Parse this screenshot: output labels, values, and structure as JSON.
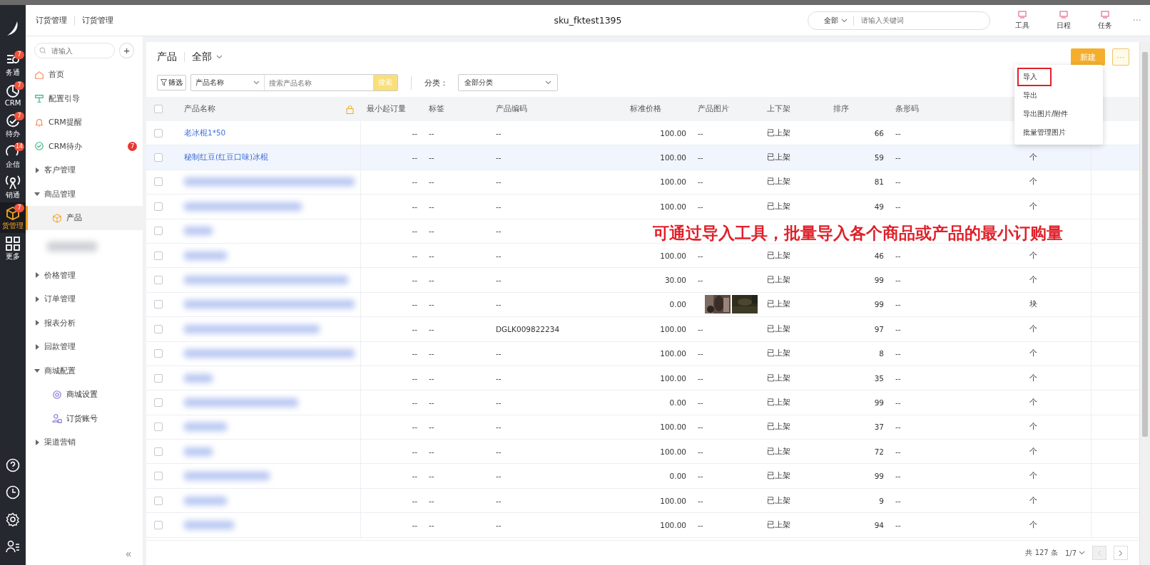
{
  "top_bar": {
    "breadcrumbs": [
      "订货管理",
      "订货管理"
    ],
    "title": "sku_fktest1395",
    "search": {
      "scope": "全部",
      "placeholder": "请输入关键词"
    },
    "tools": [
      "工具",
      "日程",
      "任务"
    ],
    "more": "···"
  },
  "rail": {
    "items": [
      {
        "label": "务通",
        "badge": "7",
        "selected": false
      },
      {
        "label": "CRM",
        "badge": "7",
        "selected": false
      },
      {
        "label": "待办",
        "badge": "7",
        "selected": false
      },
      {
        "label": "企信",
        "badge": "14",
        "selected": false
      },
      {
        "label": "销通",
        "selected": false
      },
      {
        "label": "货管理",
        "badge": "7",
        "selected": true
      },
      {
        "label": "更多",
        "selected": false
      }
    ]
  },
  "sidebar": {
    "search_placeholder": "请输入",
    "add": "+",
    "collapse": "«",
    "items": [
      {
        "kind": "link",
        "label": "首页"
      },
      {
        "kind": "link",
        "label": "配置引导"
      },
      {
        "kind": "link",
        "label": "CRM提醒"
      },
      {
        "kind": "link",
        "label": "CRM待办",
        "badge": "7"
      },
      {
        "kind": "group",
        "label": "客户管理",
        "expanded": false
      },
      {
        "kind": "group",
        "label": "商品管理",
        "expanded": true,
        "children": [
          {
            "kind": "child",
            "label": "产品",
            "selected": true
          },
          {
            "kind": "blurred",
            "selected": false
          }
        ]
      },
      {
        "kind": "group",
        "label": "价格管理",
        "expanded": false
      },
      {
        "kind": "group",
        "label": "订单管理",
        "expanded": false
      },
      {
        "kind": "group",
        "label": "报表分析",
        "expanded": false
      },
      {
        "kind": "group",
        "label": "回款管理",
        "expanded": false
      },
      {
        "kind": "group",
        "label": "商城配置",
        "expanded": true,
        "children": [
          {
            "kind": "child",
            "label": "商城设置",
            "selected": false
          },
          {
            "kind": "child",
            "label": "订货账号",
            "selected": false
          }
        ]
      },
      {
        "kind": "group",
        "label": "渠道营销",
        "expanded": false
      }
    ]
  },
  "toolbar": {
    "title": "产品",
    "view": "全部",
    "filter": "筛选",
    "field_select": "产品名称",
    "search_placeholder": "搜索产品名称",
    "search_button": "搜索",
    "category_label": "分类：",
    "category": "全部分类",
    "new_button": "新建",
    "more": "···"
  },
  "menu": {
    "items": [
      {
        "label": "导入",
        "highlighted": true
      },
      {
        "label": "导出",
        "highlighted": false
      },
      {
        "label": "导出图片/附件",
        "highlighted": false
      },
      {
        "label": "批量管理图片",
        "highlighted": false
      }
    ]
  },
  "table": {
    "all_checked": false,
    "columns": [
      "产品名称",
      "最小起订量",
      "标签",
      "产品编码",
      "标准价格",
      "产品图片",
      "上下架",
      "排序",
      "条形码"
    ],
    "rows": [
      {
        "kind": "link",
        "name": "老冰棍1*50",
        "checked": false,
        "selected": false,
        "min_qty": "--",
        "tag": "--",
        "code": "--",
        "price": "100.00",
        "image": "--",
        "shelf": "已上架",
        "sort": "66",
        "barcode": "--"
      },
      {
        "kind": "link",
        "name": "秘制红豆(红豆口味)冰棍",
        "checked": false,
        "selected": true,
        "min_qty": "--",
        "tag": "--",
        "code": "--",
        "price": "100.00",
        "image": "--",
        "shelf": "已上架",
        "sort": "59",
        "barcode": "--",
        "unit": "个"
      },
      {
        "kind": "blurred",
        "checked": false,
        "selected": false,
        "min_qty": "--",
        "tag": "--",
        "code": "--",
        "price": "100.00",
        "image": "--",
        "shelf": "已上架",
        "sort": "81",
        "barcode": "--",
        "unit": "个"
      },
      {
        "kind": "blurred",
        "checked": false,
        "selected": false,
        "min_qty": "--",
        "tag": "--",
        "code": "--",
        "price": "100.00",
        "image": "--",
        "shelf": "已上架",
        "sort": "49",
        "barcode": "--",
        "unit": "个"
      },
      {
        "kind": "blurred",
        "checked": false,
        "selected": false,
        "min_qty": "--",
        "tag": "--",
        "code": "--"
      },
      {
        "kind": "blurred",
        "checked": false,
        "selected": false,
        "min_qty": "--",
        "tag": "--",
        "code": "--",
        "price": "100.00",
        "image": "--",
        "shelf": "已上架",
        "sort": "46",
        "barcode": "--",
        "unit": "个"
      },
      {
        "kind": "blurred",
        "checked": false,
        "selected": false,
        "min_qty": "--",
        "tag": "--",
        "code": "--",
        "price": "30.00",
        "image": "--",
        "shelf": "已上架",
        "sort": "99",
        "barcode": "--",
        "unit": "个"
      },
      {
        "kind": "blurred",
        "checked": false,
        "selected": false,
        "min_qty": "--",
        "tag": "--",
        "code": "--",
        "price": "0.00",
        "shelf": "已上架",
        "sort": "99",
        "barcode": "--",
        "unit": "块"
      },
      {
        "kind": "blurred",
        "checked": false,
        "selected": false,
        "min_qty": "--",
        "tag": "--",
        "code": "DGLK009822234",
        "price": "100.00",
        "image": "--",
        "shelf": "已上架",
        "sort": "97",
        "barcode": "--",
        "unit": "个"
      },
      {
        "kind": "blurred",
        "checked": false,
        "selected": false,
        "min_qty": "--",
        "tag": "--",
        "code": "--",
        "price": "100.00",
        "image": "--",
        "shelf": "已上架",
        "sort": "8",
        "barcode": "--",
        "unit": "个"
      },
      {
        "kind": "blurred",
        "checked": false,
        "selected": false,
        "min_qty": "--",
        "tag": "--",
        "code": "--",
        "price": "100.00",
        "image": "--",
        "shelf": "已上架",
        "sort": "35",
        "barcode": "--",
        "unit": "个"
      },
      {
        "kind": "blurred",
        "checked": false,
        "selected": false,
        "min_qty": "--",
        "tag": "--",
        "code": "--",
        "price": "0.00",
        "image": "--",
        "shelf": "已上架",
        "sort": "99",
        "barcode": "--",
        "unit": "个"
      },
      {
        "kind": "blurred",
        "checked": false,
        "selected": false,
        "min_qty": "--",
        "tag": "--",
        "code": "--",
        "price": "100.00",
        "image": "--",
        "shelf": "已上架",
        "sort": "37",
        "barcode": "--",
        "unit": "个"
      },
      {
        "kind": "blurred",
        "checked": false,
        "selected": false,
        "min_qty": "--",
        "tag": "--",
        "code": "--",
        "price": "100.00",
        "image": "--",
        "shelf": "已上架",
        "sort": "72",
        "barcode": "--",
        "unit": "个"
      },
      {
        "kind": "blurred",
        "checked": false,
        "selected": false,
        "min_qty": "--",
        "tag": "--",
        "code": "--",
        "price": "0.00",
        "image": "--",
        "shelf": "已上架",
        "sort": "99",
        "barcode": "--",
        "unit": "个"
      },
      {
        "kind": "blurred",
        "checked": false,
        "selected": false,
        "min_qty": "--",
        "tag": "--",
        "code": "--",
        "price": "100.00",
        "image": "--",
        "shelf": "已上架",
        "sort": "9",
        "barcode": "--",
        "unit": "个"
      },
      {
        "kind": "blurred",
        "checked": false,
        "selected": false,
        "min_qty": "--",
        "tag": "--",
        "code": "--",
        "price": "100.00",
        "image": "--",
        "shelf": "已上架",
        "sort": "94",
        "barcode": "--",
        "unit": "个"
      }
    ]
  },
  "annotation": {
    "text": "可通过导入工具，批量导入各个商品或产品的最小订购量"
  },
  "pagination": {
    "total": "共 127 条",
    "page": "1/7",
    "prev_disabled": true
  }
}
